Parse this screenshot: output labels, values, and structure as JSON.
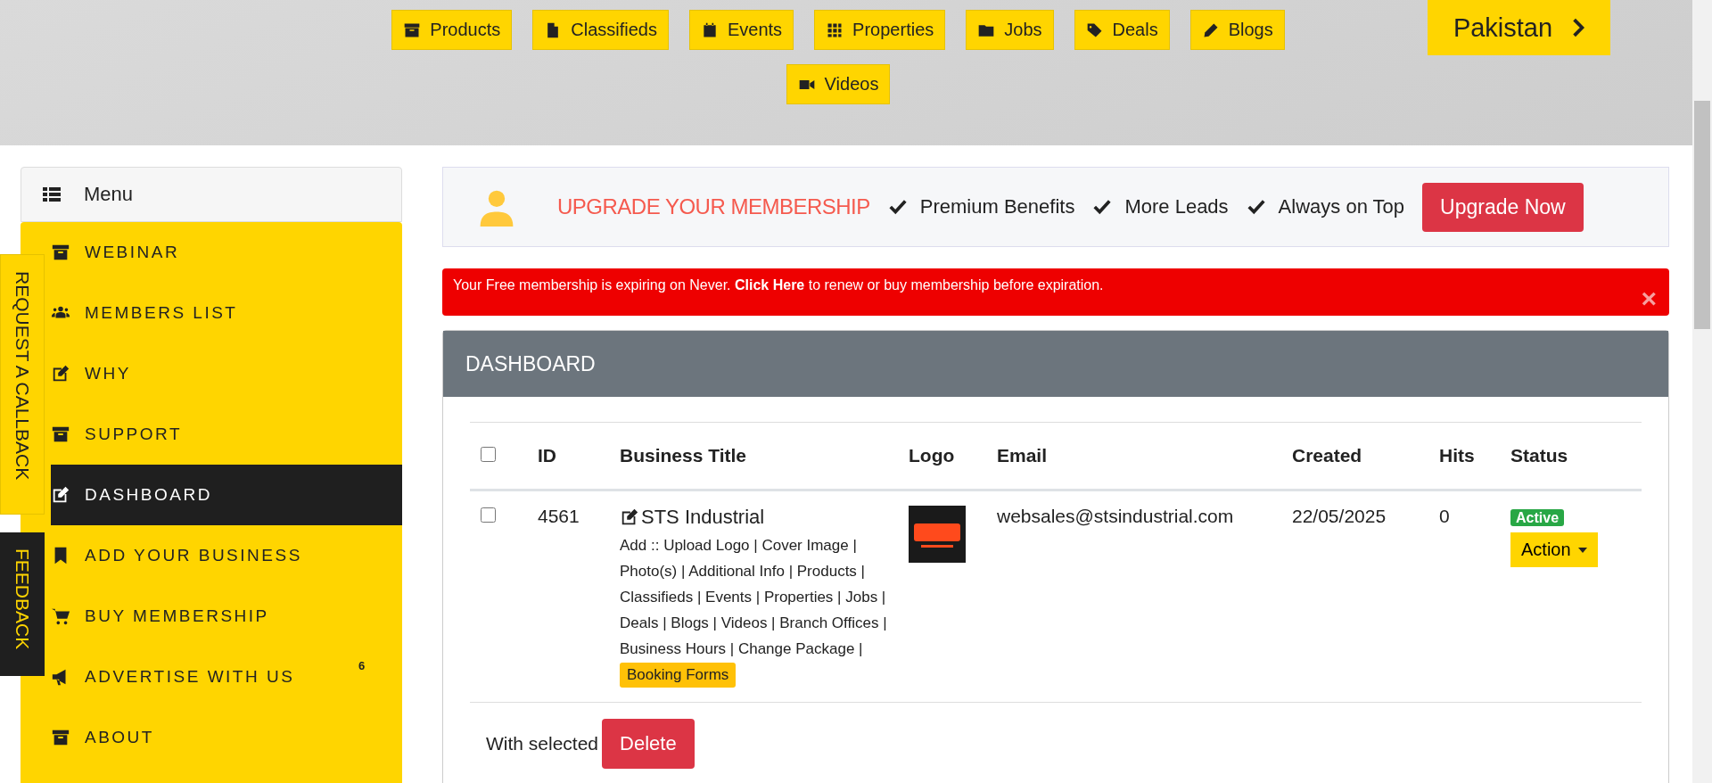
{
  "nav_buttons": [
    {
      "label": "Products"
    },
    {
      "label": "Classifieds"
    },
    {
      "label": "Events"
    },
    {
      "label": "Properties"
    },
    {
      "label": "Jobs"
    },
    {
      "label": "Deals"
    },
    {
      "label": "Blogs"
    },
    {
      "label": "Videos"
    }
  ],
  "country_button": {
    "label": "Pakistan"
  },
  "sidebar": {
    "title": "Menu",
    "items": [
      {
        "label": "WEBINAR",
        "selected": false
      },
      {
        "label": "MEMBERS LIST",
        "selected": false
      },
      {
        "label": "WHY",
        "selected": false
      },
      {
        "label": "SUPPORT",
        "selected": false
      },
      {
        "label": "DASHBOARD",
        "selected": true
      },
      {
        "label": "ADD YOUR BUSINESS",
        "selected": false
      },
      {
        "label": "BUY MEMBERSHIP",
        "selected": false
      },
      {
        "label": "ADVERTISE WITH US",
        "selected": false,
        "badge": "6"
      },
      {
        "label": "ABOUT",
        "selected": false
      }
    ]
  },
  "side_tabs": [
    {
      "label": "REQUEST A CALLBACK",
      "kind": "light"
    },
    {
      "label": "FEEDBACK",
      "kind": "dark"
    }
  ],
  "upgrade_banner": {
    "title": "UPGRADE YOUR MEMBERSHIP",
    "benefits": [
      "Premium Benefits",
      "More Leads",
      "Always on Top"
    ],
    "button": "Upgrade Now"
  },
  "alert": {
    "text": "Your Free membership is expiring on Never. **Click Here** to renew or buy membership before expiration.",
    "close": "×"
  },
  "dashboard": {
    "title": "DASHBOARD",
    "columns": [
      "ID",
      "Business Title",
      "Logo",
      "Email",
      "Created",
      "Hits",
      "Status"
    ],
    "select_all_checked": false,
    "rows": [
      {
        "checked": false,
        "id": "4561",
        "title": "STS Industrial",
        "actions": "Add :: Upload Logo | Cover Image | Photo(s) | Additional Info | Products | Classifieds | Events | Properties | Jobs | Deals | Blogs | Videos | Branch Offices | Business Hours | Change Package |",
        "booking": "Booking Forms",
        "email": "websales@stsindustrial.com",
        "created": "22/05/2025",
        "hits": "0",
        "status": "Active",
        "action": "Action"
      }
    ],
    "with_selected": "With selected",
    "delete": "Delete"
  }
}
